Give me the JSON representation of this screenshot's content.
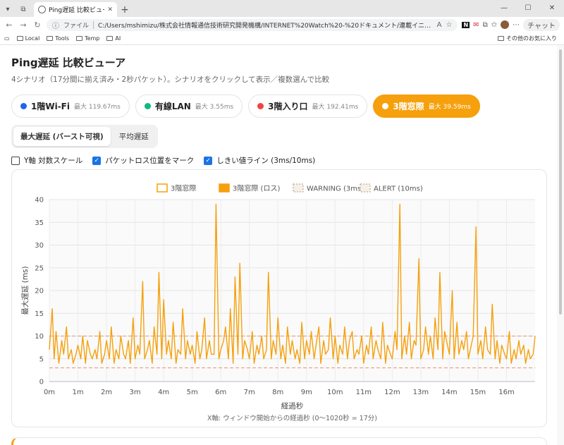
{
  "browser": {
    "tab_title": "Ping遅延 比較ビューア",
    "url_scheme": "ファイル",
    "url": "C:/Users/mshimizu/株式会社情報通信技術研究開発機構/INTERNET%20Watch%20-%20ドキュメント/連載イニシャルB/1155-遅延/artifact_ping_test.h...",
    "chat_label": "チャット",
    "bookmarks": [
      "Local",
      "Tools",
      "Temp",
      "AI"
    ],
    "other_bookmarks": "その他のお気に入り"
  },
  "page": {
    "title": "Ping遅延 比較ビューア",
    "subtitle": "4シナリオ（17分間に揃え済み・2秒パケット）。シナリオをクリックして表示／複数選んで比較"
  },
  "scenarios": [
    {
      "name": "1階Wi-Fi",
      "max_label": "最大 119.67ms",
      "color": "#2563eb",
      "active": false
    },
    {
      "name": "有線LAN",
      "max_label": "最大 3.55ms",
      "color": "#10b981",
      "active": false
    },
    {
      "name": "3階入り口",
      "max_label": "最大 192.41ms",
      "color": "#ef4444",
      "active": false
    },
    {
      "name": "3階窓際",
      "max_label": "最大 39.59ms",
      "color": "#f59e0b",
      "active": true
    }
  ],
  "modes": {
    "max": "最大遅延 (バースト可視)",
    "avg": "平均遅延"
  },
  "options": {
    "log_y": "Y軸 対数スケール",
    "mark_loss": "パケットロス位置をマーク",
    "threshold": "しきい値ライン (3ms/10ms)"
  },
  "chart_data": {
    "type": "line",
    "legend": [
      "3階窓際",
      "3階窓際 (ロス)",
      "WARNING (3ms)",
      "ALERT (10ms)"
    ],
    "ylabel": "最大遅延 (ms)",
    "xlabel": "経過秒",
    "xnote": "X軸: ウィンドウ開始からの経過秒 (0〜1020秒 = 17分)",
    "xlim": [
      0,
      1020
    ],
    "ylim": [
      0,
      40
    ],
    "yticks": [
      0,
      5,
      10,
      15,
      20,
      25,
      30,
      35,
      40
    ],
    "xticks": [
      {
        "v": 0,
        "l": "0m"
      },
      {
        "v": 60,
        "l": "1m"
      },
      {
        "v": 120,
        "l": "2m"
      },
      {
        "v": 180,
        "l": "3m"
      },
      {
        "v": 240,
        "l": "4m"
      },
      {
        "v": 300,
        "l": "5m"
      },
      {
        "v": 360,
        "l": "6m"
      },
      {
        "v": 420,
        "l": "7m"
      },
      {
        "v": 480,
        "l": "8m"
      },
      {
        "v": 540,
        "l": "9m"
      },
      {
        "v": 600,
        "l": "10m"
      },
      {
        "v": 660,
        "l": "11m"
      },
      {
        "v": 720,
        "l": "12m"
      },
      {
        "v": 780,
        "l": "13m"
      },
      {
        "v": 840,
        "l": "14m"
      },
      {
        "v": 900,
        "l": "15m"
      },
      {
        "v": 960,
        "l": "16m"
      }
    ],
    "thresholds": [
      {
        "name": "WARNING (3ms)",
        "value": 3
      },
      {
        "name": "ALERT (10ms)",
        "value": 10
      }
    ],
    "series_color": "#f5a00c",
    "threshold_color": "#e8936a",
    "series": [
      {
        "name": "3階窓際",
        "x": [
          0,
          6,
          10,
          14,
          20,
          26,
          30,
          36,
          40,
          46,
          50,
          56,
          60,
          66,
          70,
          76,
          80,
          86,
          90,
          96,
          100,
          106,
          110,
          116,
          120,
          126,
          130,
          136,
          140,
          146,
          150,
          156,
          160,
          166,
          170,
          176,
          180,
          186,
          190,
          196,
          200,
          206,
          210,
          216,
          220,
          226,
          230,
          236,
          240,
          246,
          250,
          256,
          260,
          266,
          270,
          276,
          280,
          286,
          290,
          296,
          300,
          306,
          310,
          316,
          320,
          326,
          330,
          336,
          340,
          346,
          350,
          356,
          360,
          366,
          370,
          376,
          380,
          386,
          390,
          396,
          400,
          406,
          410,
          416,
          420,
          426,
          430,
          436,
          440,
          446,
          450,
          456,
          460,
          466,
          470,
          476,
          480,
          486,
          490,
          496,
          500,
          506,
          510,
          516,
          520,
          526,
          530,
          536,
          540,
          546,
          550,
          556,
          560,
          566,
          570,
          576,
          580,
          586,
          590,
          596,
          600,
          606,
          610,
          616,
          620,
          626,
          630,
          636,
          640,
          646,
          650,
          656,
          660,
          666,
          670,
          676,
          680,
          686,
          690,
          696,
          700,
          706,
          710,
          716,
          720,
          726,
          730,
          736,
          740,
          746,
          750,
          756,
          760,
          766,
          770,
          776,
          780,
          786,
          790,
          796,
          800,
          806,
          810,
          816,
          820,
          826,
          830,
          836,
          840,
          846,
          850,
          856,
          860,
          866,
          870,
          876,
          880,
          886,
          890,
          896,
          900,
          906,
          910,
          916,
          920,
          926,
          930,
          936,
          940,
          946,
          950,
          956,
          960,
          966,
          970,
          976,
          980,
          986,
          990,
          996,
          1000,
          1006,
          1010,
          1016,
          1020
        ],
        "values": [
          7,
          16,
          5,
          11,
          4,
          9,
          6,
          12,
          5,
          7,
          4,
          6,
          8,
          5,
          10,
          4,
          9,
          6,
          5,
          7,
          5,
          11,
          4,
          6,
          9,
          5,
          12,
          4,
          7,
          5,
          10,
          6,
          5,
          9,
          4,
          14,
          5,
          8,
          6,
          22,
          5,
          7,
          9,
          4,
          12,
          6,
          24,
          5,
          18,
          6,
          9,
          5,
          13,
          4,
          7,
          6,
          16,
          5,
          9,
          6,
          8,
          4,
          11,
          5,
          7,
          14,
          5,
          9,
          6,
          6,
          39,
          5,
          7,
          9,
          12,
          5,
          16,
          4,
          23,
          6,
          26,
          5,
          9,
          7,
          5,
          11,
          4,
          8,
          6,
          10,
          5,
          7,
          24,
          5,
          9,
          6,
          14,
          5,
          8,
          4,
          12,
          6,
          9,
          5,
          7,
          4,
          13,
          5,
          9,
          6,
          11,
          5,
          8,
          12,
          4,
          9,
          6,
          7,
          14,
          5,
          10,
          4,
          8,
          6,
          12,
          5,
          9,
          11,
          5,
          7,
          6,
          10,
          4,
          8,
          6,
          12,
          5,
          9,
          7,
          5,
          13,
          4,
          8,
          6,
          5,
          11,
          7,
          39,
          5,
          10,
          6,
          13,
          5,
          9,
          8,
          27,
          5,
          7,
          12,
          6,
          10,
          5,
          14,
          7,
          24,
          5,
          11,
          8,
          6,
          20,
          5,
          13,
          6,
          9,
          7,
          11,
          5,
          8,
          10,
          34,
          6,
          9,
          5,
          12,
          7,
          6,
          17,
          5,
          9,
          4,
          8,
          6,
          5,
          11,
          4,
          7,
          5,
          9,
          6,
          8,
          4,
          7,
          5,
          6,
          10
        ]
      }
    ]
  }
}
